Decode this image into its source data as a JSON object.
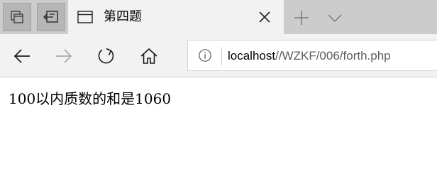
{
  "tab": {
    "title": "第四题"
  },
  "address_bar": {
    "host": "localhost",
    "path": "//WZKF/006/forth.php"
  },
  "page": {
    "text": "100以内质数的和是1060"
  },
  "icons": {
    "tab_preview": "tab-preview-icon",
    "set_aside": "set-tabs-aside-icon",
    "page": "page-icon",
    "close": "close-icon",
    "new_tab": "plus-icon",
    "tab_list": "chevron-down-icon",
    "back": "back-arrow-icon",
    "forward": "forward-arrow-icon",
    "refresh": "refresh-icon",
    "home": "home-icon",
    "info": "info-icon"
  },
  "colors": {
    "tab_strip": "#cccccc",
    "active_tab": "#f2f2f2",
    "nav_bar": "#f2f2f2",
    "url_path": "#5d5d5d"
  }
}
